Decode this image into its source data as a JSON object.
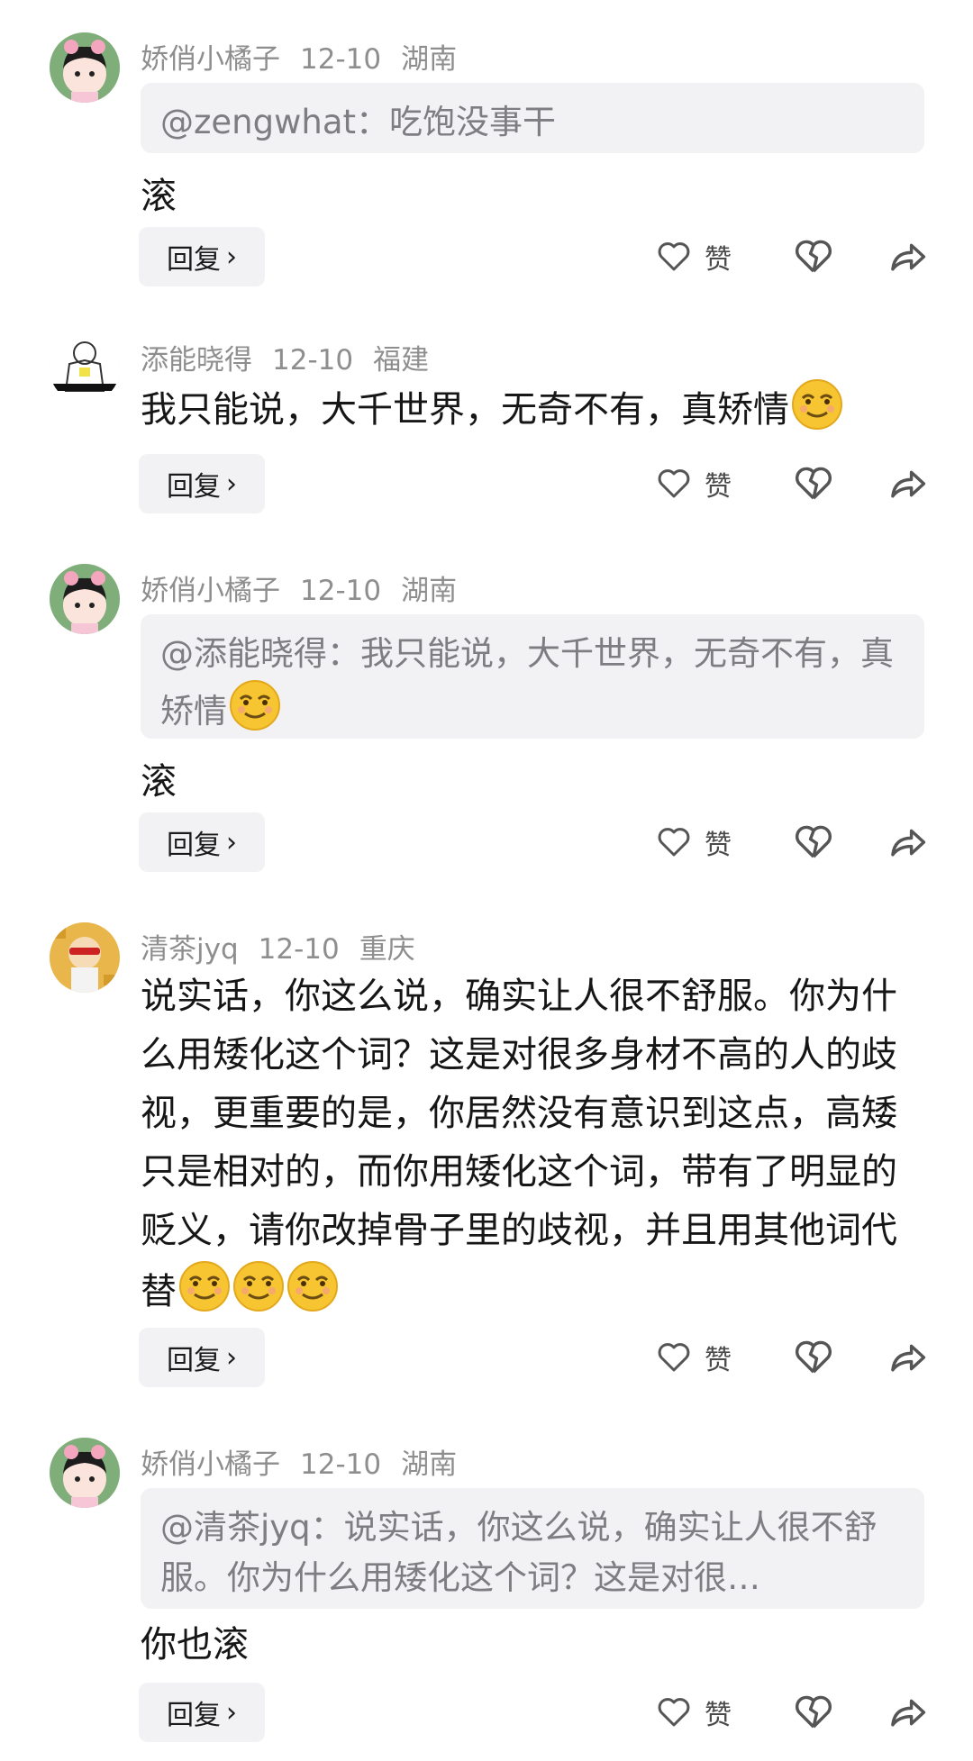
{
  "comments": [
    {
      "author": "娇俏小橘子",
      "date": "12-10",
      "location": "湖南",
      "quote": "@zengwhat：吃饱没事干",
      "text": "滚",
      "emoji_count": 0,
      "reply_label": "回复",
      "like_label": "赞",
      "avatar": "girl-avatar"
    },
    {
      "author": "添能晓得",
      "date": "12-10",
      "location": "福建",
      "quote": "",
      "text": "我只能说，大千世界，无奇不有，真矫情",
      "emoji_count": 1,
      "reply_label": "回复",
      "like_label": "赞",
      "avatar": "sketch-avatar"
    },
    {
      "author": "娇俏小橘子",
      "date": "12-10",
      "location": "湖南",
      "quote": "@添能晓得：我只能说，大千世界，无奇不有，真矫情",
      "quote_emoji_count": 1,
      "text": "滚",
      "emoji_count": 0,
      "reply_label": "回复",
      "like_label": "赞",
      "avatar": "girl-avatar"
    },
    {
      "author": "清茶jyq",
      "date": "12-10",
      "location": "重庆",
      "quote": "",
      "text": "说实话，你这么说，确实让人很不舒服。你为什么用矮化这个词？这是对很多身材不高的人的歧视，更重要的是，你居然没有意识到这点，高矮只是相对的，而你用矮化这个词，带有了明显的贬义，请你改掉骨子里的歧视，并且用其他词代替",
      "emoji_count": 3,
      "reply_label": "回复",
      "like_label": "赞",
      "avatar": "cartoon-avatar"
    },
    {
      "author": "娇俏小橘子",
      "date": "12-10",
      "location": "湖南",
      "quote": "@清茶jyq：说实话，你这么说，确实让人很不舒服。你为什么用矮化这个词？这是对很…",
      "text": "你也滚",
      "emoji_count": 0,
      "reply_label": "回复",
      "like_label": "赞",
      "avatar": "girl-avatar"
    }
  ],
  "icons": {
    "emoji": "smirk-emoji-icon",
    "like": "heart-icon",
    "dislike": "broken-heart-icon",
    "share": "share-arrow-icon",
    "chevron": "chevron-right-icon"
  }
}
